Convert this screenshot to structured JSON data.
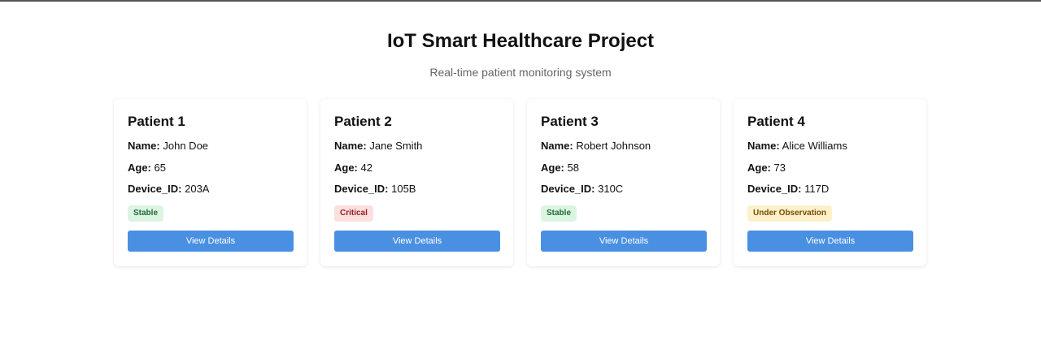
{
  "header": {
    "title": "IoT Smart Healthcare Project",
    "subtitle": "Real-time patient monitoring system"
  },
  "labels": {
    "name": "Name:",
    "age": "Age:",
    "device_id": "Device_ID:"
  },
  "patients": [
    {
      "heading": "Patient 1",
      "name": "John Doe",
      "age": "65",
      "device_id": "203A",
      "status": "Stable",
      "status_color": "#1e6b35",
      "button": "View Details"
    },
    {
      "heading": "Patient 2",
      "name": "Jane Smith",
      "age": "42",
      "device_id": "105B",
      "status": "Critical",
      "status_color": "#9b1c1c",
      "button": "View Details"
    },
    {
      "heading": "Patient 3",
      "name": "Robert Johnson",
      "age": "58",
      "device_id": "310C",
      "status": "Stable",
      "status_color": "#1e6b35",
      "button": "View Details"
    },
    {
      "heading": "Patient 4",
      "name": "Alice Williams",
      "age": "73",
      "device_id": "117D",
      "status": "Under Observation",
      "status_color": "#7a4b00",
      "button": "View Details"
    }
  ],
  "colors": {
    "button": "#4a90e2"
  }
}
